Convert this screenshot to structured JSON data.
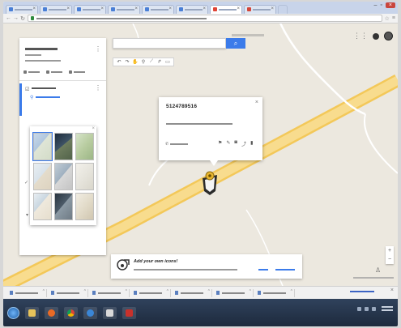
{
  "infowindow": {
    "title": "5124789516 "
  },
  "notification": {
    "title": "Add your own icons!"
  },
  "colors": {
    "accent": "#3b7bea",
    "road": "#f6cf6a",
    "map_background": "#ece8df",
    "marker": "#2b2b2b",
    "taskbar": "#1d2a3d"
  },
  "icons": {
    "search": "search-icon",
    "apps": "apps-grid-icon",
    "marker": "map-marker-icon",
    "zoom_in": "plus-icon",
    "zoom_out": "minus-icon",
    "pegman": "pegman-icon"
  }
}
